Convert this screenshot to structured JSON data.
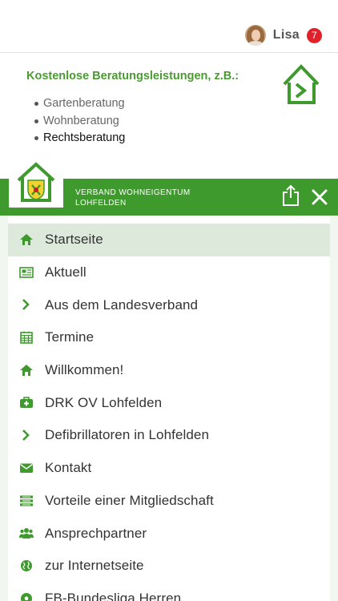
{
  "user": {
    "name": "Lisa",
    "notifications": "7"
  },
  "banner": {
    "title": "Kostenlose Beratungsleistungen, z.B.:",
    "services": [
      "Gartenberatung",
      "Wohnberatung",
      "Rechtsberatung"
    ]
  },
  "brand": {
    "line1": "VERBAND WOHNEIGENTUM",
    "line2": "LOHFELDEN"
  },
  "colors": {
    "green": "#3f9a2e",
    "active": "#dde9db",
    "icon": "#3f9a2e",
    "badge": "#e0202a"
  },
  "menu": [
    {
      "label": "Startseite",
      "icon": "home-icon",
      "active": true
    },
    {
      "label": "Aktuell",
      "icon": "newspaper-icon"
    },
    {
      "label": "Aus dem Landesverband",
      "icon": "chevron-right-icon"
    },
    {
      "label": "Termine",
      "icon": "calendar-icon"
    },
    {
      "label": "Willkommen!",
      "icon": "home-icon"
    },
    {
      "label": "DRK OV Lohfelden",
      "icon": "medkit-icon"
    },
    {
      "label": "Defibrillatoren in Lohfelden",
      "icon": "chevron-right-icon"
    },
    {
      "label": "Kontakt",
      "icon": "envelope-icon"
    },
    {
      "label": "Vorteile einer Mitgliedschaft",
      "icon": "list-icon"
    },
    {
      "label": "Ansprechpartner",
      "icon": "group-icon"
    },
    {
      "label": "zur Internetseite",
      "icon": "globe-icon"
    },
    {
      "label": "FB-Bundesliga Herren",
      "icon": "soccer-ball-icon"
    }
  ]
}
